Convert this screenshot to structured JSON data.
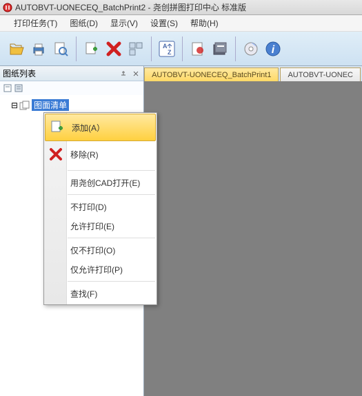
{
  "title": "AUTOBVT-UONECEQ_BatchPrint2 - 尧创拼图打印中心 标准版",
  "menu": {
    "print_tasks": "打印任务(T)",
    "drawings": "图纸(D)",
    "display": "显示(V)",
    "settings": "设置(S)",
    "help": "帮助(H)"
  },
  "panel": {
    "title": "图纸列表",
    "tree_root": "图面清单"
  },
  "tabs": {
    "active": "AUTOBVT-UONECEQ_BatchPrint1",
    "inactive": "AUTOBVT-UONEC"
  },
  "ctx": {
    "add": "添加(A）",
    "remove": "移除(R)",
    "open_cad": "用尧创CAD打开(E)",
    "no_print": "不打印(D)",
    "allow_print": "允许打印(E)",
    "only_no_print": "仅不打印(O)",
    "only_allow_print": "仅允许打印(P)",
    "find": "查找(F)"
  }
}
